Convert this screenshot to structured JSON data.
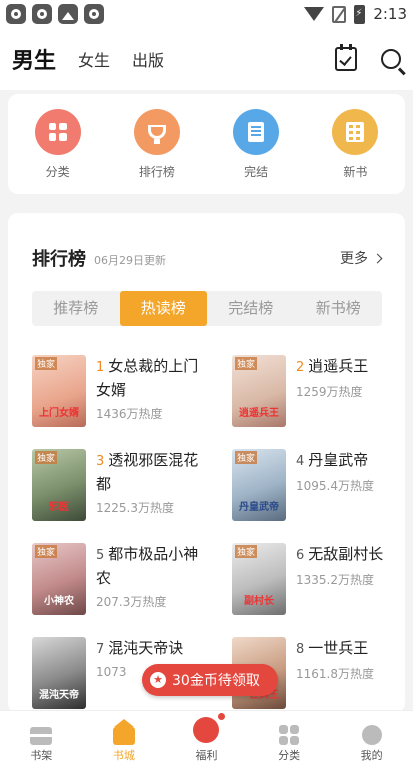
{
  "status_bar": {
    "time": "2:13"
  },
  "header": {
    "tabs": [
      {
        "label": "男生",
        "active": true
      },
      {
        "label": "女生",
        "active": false
      },
      {
        "label": "出版",
        "active": false
      }
    ]
  },
  "quick": {
    "items": [
      {
        "label": "分类",
        "icon": "grid-icon",
        "color": "#f07b6e"
      },
      {
        "label": "排行榜",
        "icon": "trophy-icon",
        "color": "#f39a62"
      },
      {
        "label": "完结",
        "icon": "book-icon",
        "color": "#58a7e6"
      },
      {
        "label": "新书",
        "icon": "building-icon",
        "color": "#f0b84c"
      }
    ]
  },
  "ranking": {
    "title": "排行榜",
    "date": "06月29日更新",
    "more": "更多",
    "tabs": [
      "推荐榜",
      "热读榜",
      "完结榜",
      "新书榜"
    ],
    "active_tab": "热读榜",
    "books": [
      {
        "rank": "1",
        "title": "女总裁的上门女婿",
        "heat": "1436万热度",
        "cover_tag": "独家",
        "cover_title": "上门女婿"
      },
      {
        "rank": "2",
        "title": "逍遥兵王",
        "heat": "1259万热度",
        "cover_tag": "独家",
        "cover_title": "逍遥兵王"
      },
      {
        "rank": "3",
        "title": "透视邪医混花都",
        "heat": "1225.3万热度",
        "cover_tag": "独家",
        "cover_title": "邪医"
      },
      {
        "rank": "4",
        "title": "丹皇武帝",
        "heat": "1095.4万热度",
        "cover_tag": "独家",
        "cover_title": "丹皇武帝"
      },
      {
        "rank": "5",
        "title": "都市极品小神农",
        "heat": "207.3万热度",
        "cover_tag": "独家",
        "cover_title": "小神农"
      },
      {
        "rank": "6",
        "title": "无敌副村长",
        "heat": "1335.2万热度",
        "cover_tag": "独家",
        "cover_title": "副村长"
      },
      {
        "rank": "7",
        "title": "混沌天帝诀",
        "heat": "1073",
        "cover_tag": "",
        "cover_title": "混沌天帝"
      },
      {
        "rank": "8",
        "title": "一世兵王",
        "heat": "1161.8万热度",
        "cover_tag": "",
        "cover_title": "一世兵王"
      }
    ]
  },
  "coin_popup": {
    "text": "30金币待领取"
  },
  "bottom_nav": {
    "items": [
      {
        "label": "书架",
        "icon": "bookshelf-icon",
        "active": false
      },
      {
        "label": "书城",
        "icon": "home-icon",
        "active": true
      },
      {
        "label": "福利",
        "icon": "gift-icon",
        "active": false
      },
      {
        "label": "分类",
        "icon": "category-icon",
        "active": false
      },
      {
        "label": "我的",
        "icon": "profile-icon",
        "active": false
      }
    ]
  }
}
